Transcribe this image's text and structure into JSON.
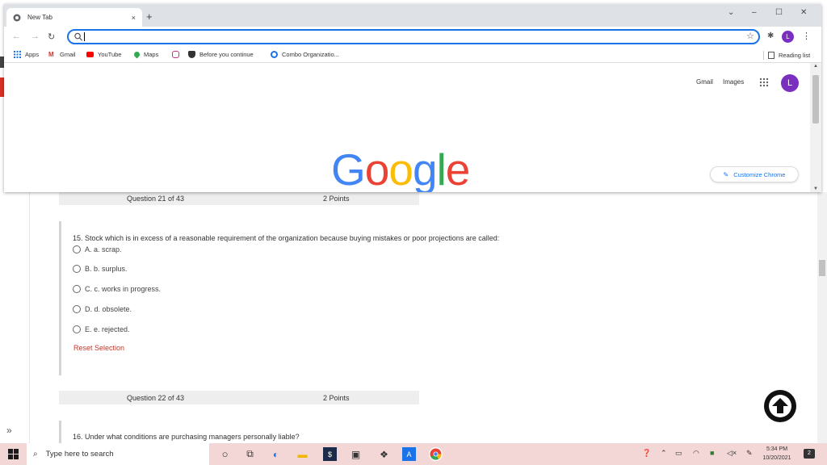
{
  "browser": {
    "tab_title": "New Tab",
    "tab_close": "×",
    "new_tab": "+",
    "window_controls": [
      "⌄",
      "–",
      "☐",
      "✕"
    ],
    "omnibox_value": "",
    "profile_initial": "L"
  },
  "bookmarks": [
    {
      "label": "Apps",
      "icon": "apps-grid-icon",
      "color": "#1a73e8"
    },
    {
      "label": "Gmail",
      "icon": "gmail-icon",
      "color": "#d93025"
    },
    {
      "label": "YouTube",
      "icon": "youtube-icon",
      "color": "#ff0000"
    },
    {
      "label": "Maps",
      "icon": "maps-pin-icon",
      "color": "#34a853"
    },
    {
      "label": "",
      "icon": "instagram-icon",
      "color": "#c13584"
    },
    {
      "label": "Before you continue",
      "icon": "shield-icon",
      "color": "#333333"
    },
    {
      "label": "Combo Organizatio...",
      "icon": "q-logo-icon",
      "color": "#1a73e8"
    }
  ],
  "reading_list": "Reading list",
  "ntp": {
    "gmail": "Gmail",
    "images": "Images",
    "profile_initial": "L",
    "logo_letters": [
      {
        "ch": "G",
        "color": "#4285f4"
      },
      {
        "ch": "o",
        "color": "#ea4335"
      },
      {
        "ch": "o",
        "color": "#fbbc05"
      },
      {
        "ch": "g",
        "color": "#4285f4"
      },
      {
        "ch": "l",
        "color": "#34a853"
      },
      {
        "ch": "e",
        "color": "#ea4335"
      }
    ],
    "customize": "Customize Chrome"
  },
  "quiz": {
    "q21": {
      "header": "Question 21 of 43",
      "points": "2 Points"
    },
    "q21_text": "15. Stock which is in excess of a reasonable requirement of the organization because buying mistakes or poor projections are called:",
    "options": [
      "A. a. scrap.",
      "B. b. surplus.",
      "C. c. works in progress.",
      "D. d. obsolete.",
      "E. e. rejected."
    ],
    "reset": "Reset Selection",
    "q22": {
      "header": "Question 22 of 43",
      "points": "2 Points"
    },
    "q22_text": "16. Under what conditions are purchasing managers personally liable?",
    "expander": "»"
  },
  "taskbar": {
    "search_placeholder": "Type here to search",
    "time": "5:34 PM",
    "date": "10/20/2021",
    "notifications": "2",
    "tray_icons": [
      "help-icon",
      "chevron-up-icon",
      "display-icon",
      "wifi-icon",
      "app-tray-icon",
      "volume-mute-icon",
      "pen-icon"
    ]
  }
}
